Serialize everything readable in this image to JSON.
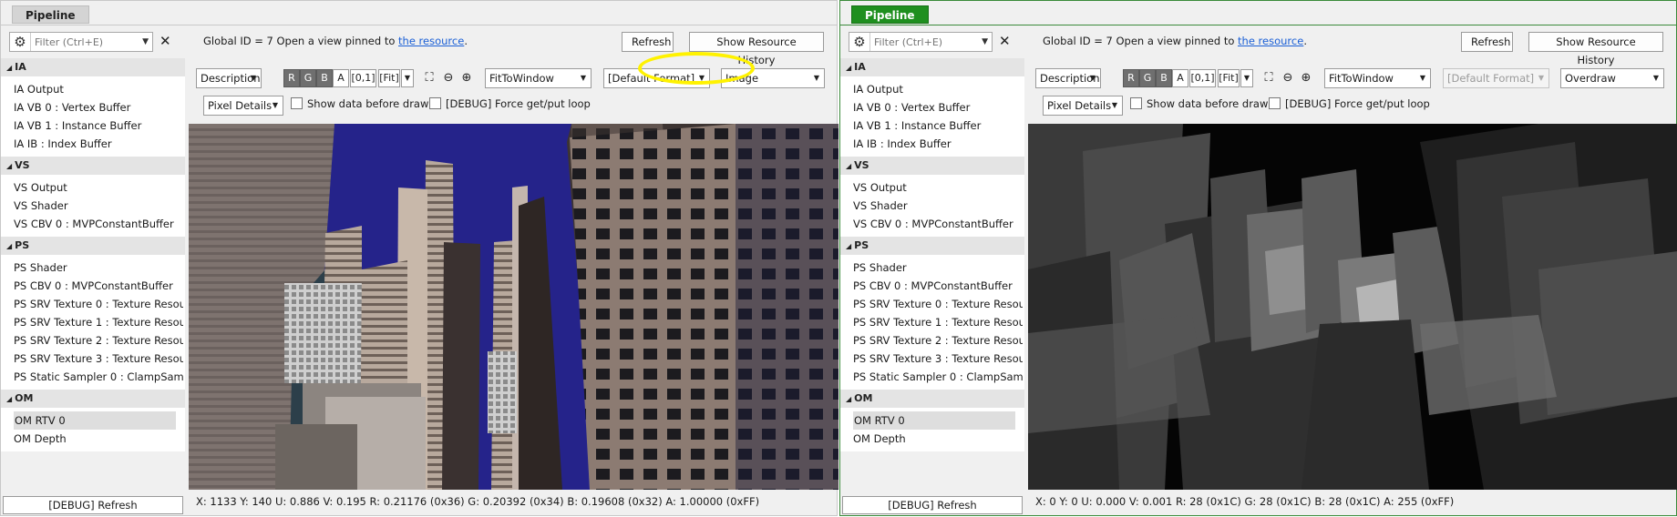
{
  "tab_label": "Pipeline",
  "filter_placeholder": "Filter (Ctrl+E)",
  "global_id_text": "Global ID = 7   Open a view pinned to ",
  "resource_link": "the resource",
  "resource_link_suffix": ".",
  "refresh_label": "Refresh",
  "history_label": "Show Resource History",
  "debug_refresh": "[DEBUG] Refresh",
  "channels": [
    "R",
    "G",
    "B",
    "A"
  ],
  "range_label": "[0,1]",
  "fit_label": "[Fit]",
  "show_data_label": "Show data before draw",
  "force_loop_label": "[DEBUG] Force get/put loop",
  "sections": [
    {
      "title": "IA",
      "items": [
        "IA Output",
        "IA VB 0 : Vertex Buffer",
        "IA VB 1 : Instance Buffer",
        "IA IB : Index Buffer"
      ]
    },
    {
      "title": "VS",
      "items": [
        "VS Output",
        "VS Shader",
        "VS CBV 0 : MVPConstantBuffer"
      ]
    },
    {
      "title": "PS",
      "items": [
        "PS Shader",
        "PS CBV 0 : MVPConstantBuffer",
        "PS SRV Texture 0 : Texture Resou",
        "PS SRV Texture 1 : Texture Resou",
        "PS SRV Texture 2 : Texture Resou",
        "PS SRV Texture 3 : Texture Resou",
        "PS Static Sampler 0 : ClampSamp"
      ]
    },
    {
      "title": "OM",
      "items": [
        "OM RTV 0",
        "OM Depth"
      ]
    }
  ],
  "selected_item": "OM RTV 0",
  "left": {
    "description": "Description",
    "zoom_mode": "FitToWindow",
    "format": "[Default Format]",
    "view_mode": "Image",
    "pixel_details": "Pixel Details",
    "status": "X: 1133  Y: 140  U: 0.886  V: 0.195  R: 0.21176 (0x36)  G: 0.20392 (0x34)  B: 0.19608 (0x32)  A: 1.00000 (0xFF)"
  },
  "right": {
    "description": "Description",
    "zoom_mode": "FitToWindow",
    "format": "[Default Format]",
    "view_mode": "Overdraw",
    "pixel_details": "Pixel Details",
    "status": "X: 0  Y: 0  U: 0.000  V: 0.001  R: 28 (0x1C)  G: 28 (0x1C)  B: 28 (0x1C)  A: 255 (0xFF)"
  },
  "icons": {
    "gear": "gear-icon",
    "clear": "close-icon",
    "fit": "fit-to-window-icon",
    "zoom_out": "zoom-out-icon",
    "zoom_in": "zoom-in-icon",
    "dropdown": "chevron-down-icon",
    "collapse": "collapse-triangle-icon"
  },
  "colors": {
    "active_tab": "#1f8f1f",
    "highlight": "#fff200",
    "link": "#1a5fd6",
    "sky": "#25238a"
  }
}
